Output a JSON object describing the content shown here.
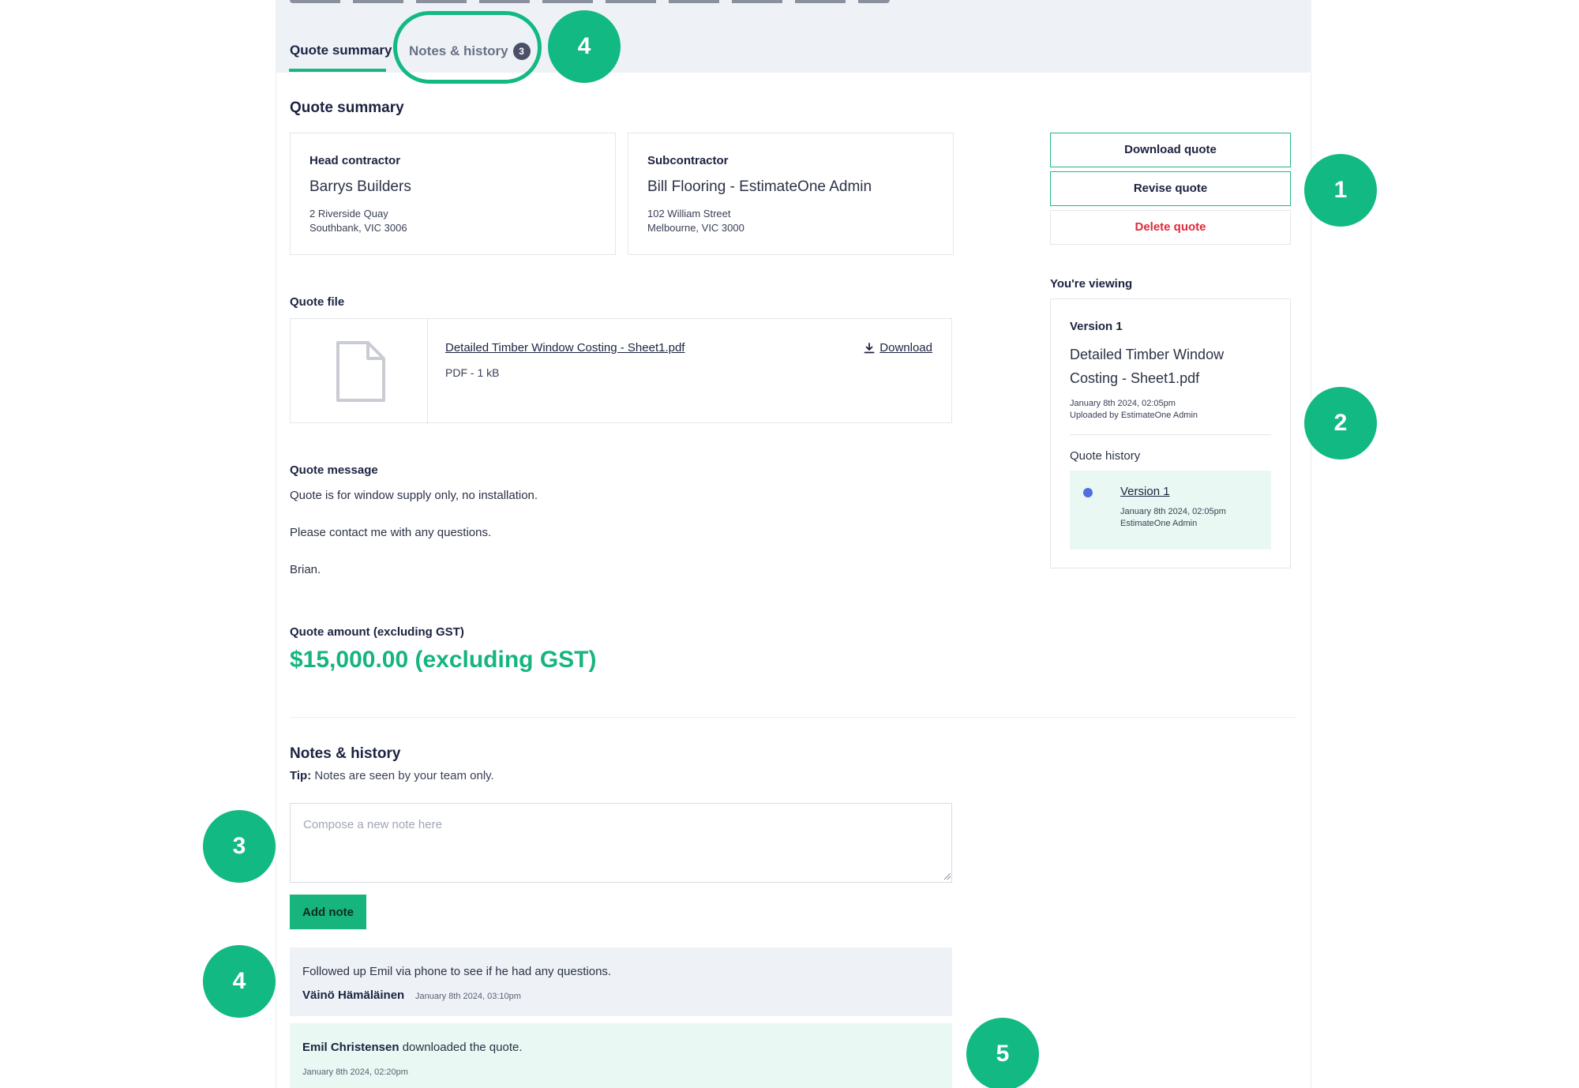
{
  "tabs": [
    {
      "label": "Quote summary",
      "active": true
    },
    {
      "label": "Notes & history",
      "badge": "3",
      "active": false
    }
  ],
  "summary": {
    "heading": "Quote summary",
    "head_contractor": {
      "role": "Head contractor",
      "name": "Barrys Builders",
      "address_line1": "2 Riverside Quay",
      "address_line2": "Southbank, VIC 3006"
    },
    "subcontractor": {
      "role": "Subcontractor",
      "name": "Bill Flooring - EstimateOne Admin",
      "address_line1": "102 William Street",
      "address_line2": "Melbourne, VIC 3000"
    }
  },
  "actions": {
    "download": "Download quote",
    "revise": "Revise quote",
    "delete": "Delete quote"
  },
  "quote_file": {
    "label": "Quote file",
    "name": "Detailed Timber Window Costing - Sheet1.pdf",
    "meta": "PDF - 1 kB",
    "download_label": "Download"
  },
  "quote_message": {
    "label": "Quote message",
    "lines": [
      "Quote is for window supply only, no installation.",
      "Please contact me with any questions.",
      "Brian."
    ]
  },
  "quote_amount": {
    "label": "Quote amount (excluding GST)",
    "value": "$15,000.00 (excluding GST)"
  },
  "viewing": {
    "label": "You're viewing",
    "version": "Version 1",
    "file_line1": "Detailed Timber Window",
    "file_line2": "Costing - Sheet1.pdf",
    "date": "January 8th 2024, 02:05pm",
    "uploaded_by": "Uploaded by EstimateOne Admin",
    "history_label": "Quote history",
    "history": [
      {
        "version": "Version 1",
        "date": "January 8th 2024, 02:05pm",
        "user": "EstimateOne Admin"
      }
    ]
  },
  "notes": {
    "heading": "Notes & history",
    "tip_label": "Tip:",
    "tip_text": " Notes are seen by your team only.",
    "input_placeholder": "Compose a new note here",
    "add_button": "Add note",
    "items": [
      {
        "body": "Followed up Emil via phone to see if he had any questions.",
        "author": "Väinö Hämäläinen",
        "time": "January 8th 2024, 03:10pm"
      },
      {
        "actor": "Emil Christensen",
        "body": " downloaded the quote.",
        "time": "January 8th 2024, 02:20pm"
      }
    ]
  },
  "markers": [
    "1",
    "2",
    "3",
    "4",
    "4",
    "5"
  ],
  "colors": {
    "accent_green": "#12b982",
    "amount_green": "#16b57e",
    "delete_red": "#e0293b",
    "header_band": "#eef2f7",
    "history_highlight": "#e9f8f2",
    "version_dot": "#4f6fe0"
  }
}
